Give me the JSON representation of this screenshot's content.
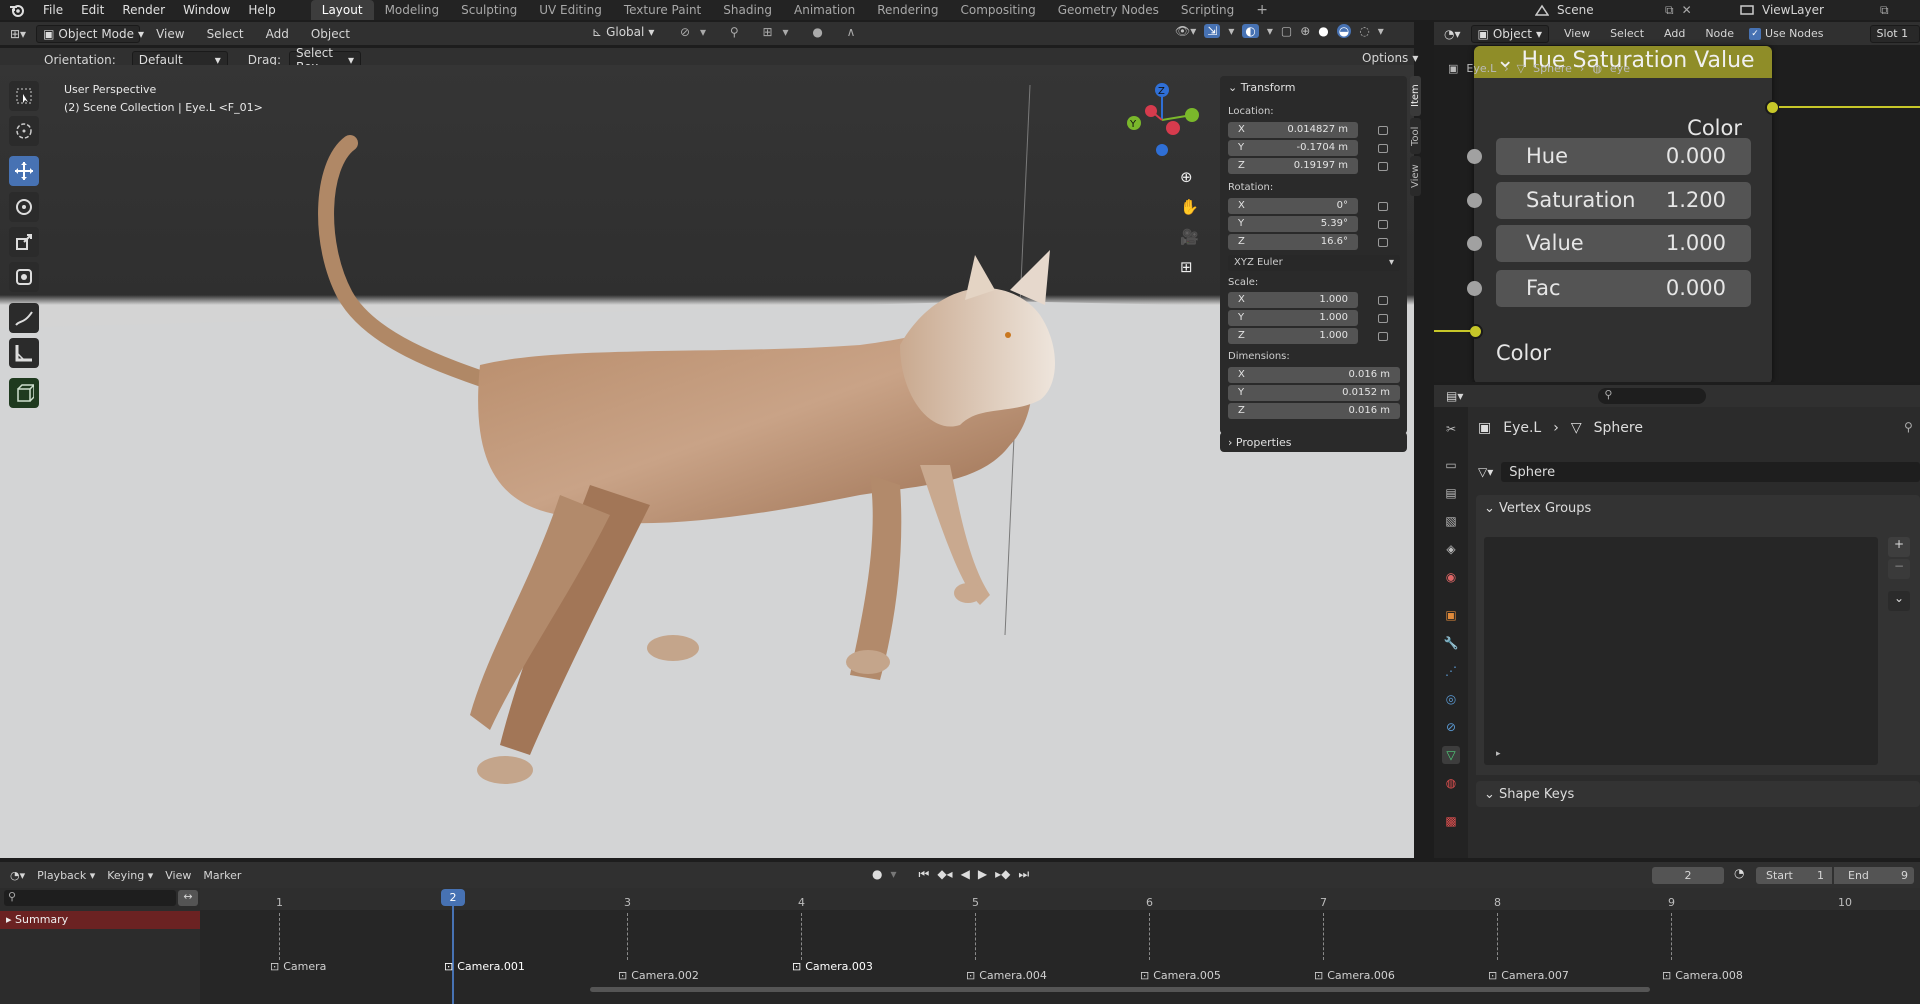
{
  "topbar": {
    "menus": [
      "File",
      "Edit",
      "Render",
      "Window",
      "Help"
    ],
    "tabs": [
      "Layout",
      "Modeling",
      "Sculpting",
      "UV Editing",
      "Texture Paint",
      "Shading",
      "Animation",
      "Rendering",
      "Compositing",
      "Geometry Nodes",
      "Scripting"
    ],
    "active_tab": "Layout",
    "scene": "Scene",
    "view_layer": "ViewLayer"
  },
  "viewport_header": {
    "mode": "Object Mode",
    "menus": [
      "View",
      "Select",
      "Add",
      "Object"
    ],
    "transform_orientation": "Global",
    "orientation_label": "Orientation:",
    "orientation_value": "Default",
    "drag_label": "Drag:",
    "drag_value": "Select Box",
    "options": "Options"
  },
  "viewport": {
    "perspective": "User Perspective",
    "collection": "(2) Scene Collection | Eye.L <F_01>",
    "side_tabs": [
      "Item",
      "Tool",
      "View"
    ]
  },
  "transform_panel": {
    "title": "Transform",
    "location_label": "Location:",
    "location": [
      {
        "axis": "X",
        "value": "0.014827 m"
      },
      {
        "axis": "Y",
        "value": "-0.1704 m"
      },
      {
        "axis": "Z",
        "value": "0.19197 m"
      }
    ],
    "rotation_label": "Rotation:",
    "rotation": [
      {
        "axis": "X",
        "value": "0°"
      },
      {
        "axis": "Y",
        "value": "5.39°"
      },
      {
        "axis": "Z",
        "value": "16.6°"
      }
    ],
    "rotation_mode": "XYZ Euler",
    "scale_label": "Scale:",
    "scale": [
      {
        "axis": "X",
        "value": "1.000"
      },
      {
        "axis": "Y",
        "value": "1.000"
      },
      {
        "axis": "Z",
        "value": "1.000"
      }
    ],
    "dimensions_label": "Dimensions:",
    "dimensions": [
      {
        "axis": "X",
        "value": "0.016 m"
      },
      {
        "axis": "Y",
        "value": "0.0152 m"
      },
      {
        "axis": "Z",
        "value": "0.016 m"
      }
    ],
    "properties_label": "Properties"
  },
  "node_editor": {
    "object_select": "Object",
    "menus": [
      "View",
      "Select",
      "Add",
      "Node"
    ],
    "use_nodes_label": "Use Nodes",
    "slot": "Slot 1",
    "breadcrumb": [
      "Eye.L",
      "Sphere",
      "eye"
    ],
    "node_title": "Hue Saturation Value",
    "output_label": "Color",
    "inputs": [
      {
        "name": "Hue",
        "value": "0.000"
      },
      {
        "name": "Saturation",
        "value": "1.200"
      },
      {
        "name": "Value",
        "value": "1.000"
      },
      {
        "name": "Fac",
        "value": "0.000"
      }
    ],
    "input_color_label": "Color"
  },
  "properties": {
    "breadcrumb_object": "Eye.L",
    "breadcrumb_data": "Sphere",
    "mesh_name": "Sphere",
    "vertex_groups": "Vertex Groups",
    "shape_keys": "Shape Keys"
  },
  "timeline": {
    "menus": [
      "Playback",
      "Keying",
      "View",
      "Marker"
    ],
    "current_frame": "2",
    "start_label": "Start",
    "start": "1",
    "end_label": "End",
    "end": "9",
    "summary": "Summary",
    "ticks": [
      "1",
      "2",
      "3",
      "4",
      "5",
      "6",
      "7",
      "8",
      "9",
      "10"
    ],
    "markers": [
      "Camera",
      "Camera.001",
      "Camera.002",
      "Camera.003",
      "Camera.004",
      "Camera.005",
      "Camera.006",
      "Camera.007",
      "Camera.008"
    ]
  },
  "colors": {
    "accent": "#4772b3",
    "node_header": "#8f8d28",
    "socket_yellow": "#c7c729",
    "socket_gray": "#a1a1a1",
    "summary_red": "#6b2222"
  }
}
